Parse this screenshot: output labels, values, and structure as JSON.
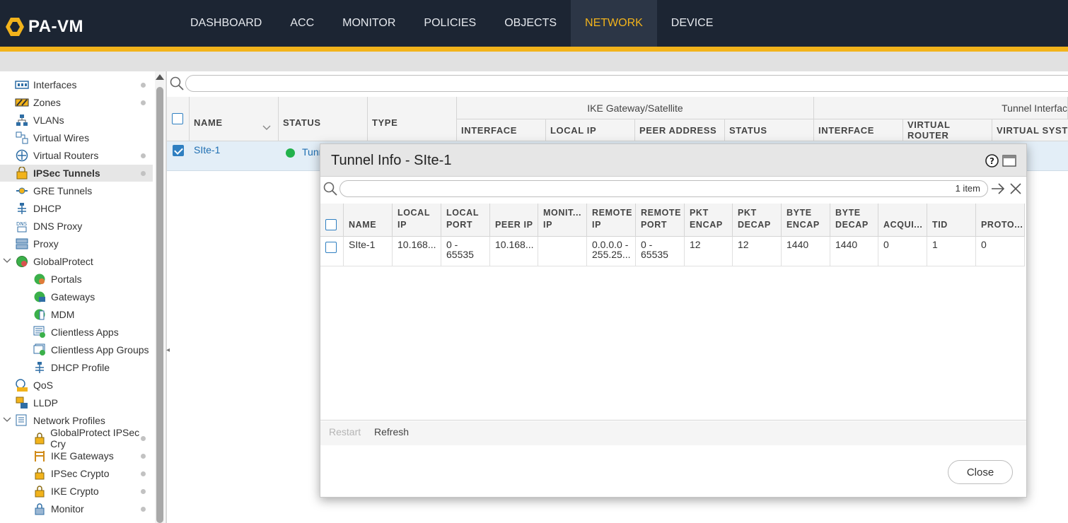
{
  "brand": "PA-VM",
  "nav": {
    "tabs": [
      {
        "label": "DASHBOARD"
      },
      {
        "label": "ACC"
      },
      {
        "label": "MONITOR"
      },
      {
        "label": "POLICIES"
      },
      {
        "label": "OBJECTS"
      },
      {
        "label": "NETWORK",
        "active": true
      },
      {
        "label": "DEVICE"
      }
    ]
  },
  "sidebar": {
    "items": [
      {
        "label": "Interfaces",
        "icon": "interfaces-icon"
      },
      {
        "label": "Zones",
        "icon": "zones-icon"
      },
      {
        "label": "VLANs",
        "icon": "vlans-icon"
      },
      {
        "label": "Virtual Wires",
        "icon": "virtual-wires-icon"
      },
      {
        "label": "Virtual Routers",
        "icon": "virtual-routers-icon"
      },
      {
        "label": "IPSec Tunnels",
        "icon": "ipsec-tunnels-icon",
        "selected": true
      },
      {
        "label": "GRE Tunnels",
        "icon": "gre-tunnels-icon"
      },
      {
        "label": "DHCP",
        "icon": "dhcp-icon"
      },
      {
        "label": "DNS Proxy",
        "icon": "dns-proxy-icon"
      },
      {
        "label": "Proxy",
        "icon": "proxy-icon"
      },
      {
        "label": "GlobalProtect",
        "icon": "globalprotect-icon"
      },
      {
        "label": "Portals",
        "icon": "portals-icon"
      },
      {
        "label": "Gateways",
        "icon": "gateways-icon"
      },
      {
        "label": "MDM",
        "icon": "mdm-icon"
      },
      {
        "label": "Clientless Apps",
        "icon": "clientless-apps-icon"
      },
      {
        "label": "Clientless App Groups",
        "icon": "clientless-app-groups-icon"
      },
      {
        "label": "DHCP Profile",
        "icon": "dhcp-profile-icon"
      },
      {
        "label": "QoS",
        "icon": "qos-icon"
      },
      {
        "label": "LLDP",
        "icon": "lldp-icon"
      },
      {
        "label": "Network Profiles",
        "icon": "network-profiles-icon"
      },
      {
        "label": "GlobalProtect IPSec Cry",
        "icon": "lock-icon"
      },
      {
        "label": "IKE Gateways",
        "icon": "ike-gateways-icon"
      },
      {
        "label": "IPSec Crypto",
        "icon": "lock-icon"
      },
      {
        "label": "IKE Crypto",
        "icon": "lock-icon"
      },
      {
        "label": "Monitor",
        "icon": "monitor-icon"
      }
    ]
  },
  "table": {
    "group_headers": {
      "ike": "IKE Gateway/Satellite",
      "tunnel": "Tunnel Interfac"
    },
    "headers": {
      "name": "NAME",
      "status": "STATUS",
      "type": "TYPE",
      "interface": "INTERFACE",
      "local_ip": "LOCAL IP",
      "peer_address": "PEER ADDRESS",
      "ike_status": "STATUS",
      "tunnel_interface": "INTERFACE",
      "virtual_router": "VIRTUAL ROUTER",
      "virtual_system": "VIRTUAL SYSTE"
    },
    "rows": [
      {
        "name": "SIte-1",
        "status": "Tunn"
      }
    ]
  },
  "modal": {
    "title": "Tunnel Info - SIte-1",
    "item_count": "1 item",
    "columns": [
      "NAME",
      "LOCAL\nIP",
      "LOCAL\nPORT",
      "PEER IP",
      "MONIT...\nIP",
      "REMOTE\nIP",
      "REMOTE\nPORT",
      "PKT\nENCAP",
      "PKT\nDECAP",
      "BYTE\nENCAP",
      "BYTE\nDECAP",
      "ACQUI...",
      "TID",
      "PROTO..."
    ],
    "rows": [
      {
        "cells": [
          "SIte-1",
          "10.168...",
          "0 -\n65535",
          "10.168...",
          "",
          "0.0.0.0 -\n255.25...",
          "0 -\n65535",
          "12",
          "12",
          "1440",
          "1440",
          "0",
          "1",
          "0"
        ]
      }
    ],
    "actions": {
      "restart": "Restart",
      "refresh": "Refresh",
      "close": "Close"
    }
  },
  "colors": {
    "nav_bg": "#1c2533",
    "accent": "#f2b31b",
    "link": "#1f6fb2",
    "status_ok": "#22b24c"
  }
}
